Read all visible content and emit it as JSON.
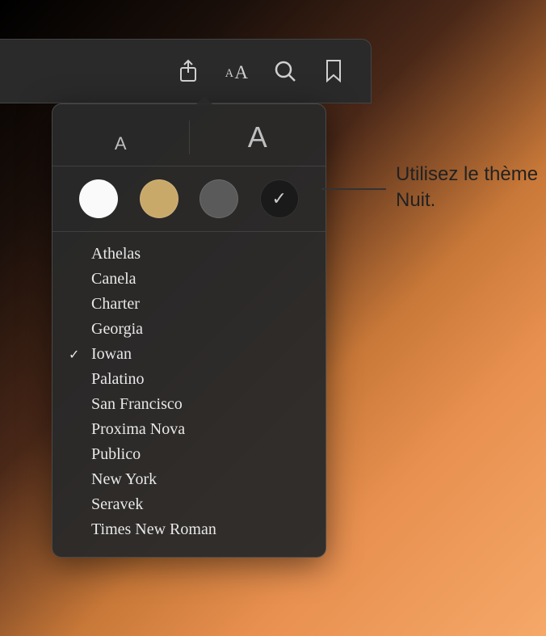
{
  "toolbar": {
    "icons": {
      "share": "share-icon",
      "appearance": "appearance-icon",
      "search": "search-icon",
      "bookmark": "bookmark-icon"
    }
  },
  "popover": {
    "size_small": "A",
    "size_large": "A",
    "themes": {
      "white": "#fafafa",
      "sepia": "#c9a96a",
      "gray": "#5a5a5a",
      "night": "#1a1a1a",
      "selected": "night"
    },
    "fonts": [
      {
        "label": "Athelas",
        "selected": false
      },
      {
        "label": "Canela",
        "selected": false
      },
      {
        "label": "Charter",
        "selected": false
      },
      {
        "label": "Georgia",
        "selected": false
      },
      {
        "label": "Iowan",
        "selected": true
      },
      {
        "label": "Palatino",
        "selected": false
      },
      {
        "label": "San Francisco",
        "selected": false
      },
      {
        "label": "Proxima Nova",
        "selected": false
      },
      {
        "label": "Publico",
        "selected": false
      },
      {
        "label": "New York",
        "selected": false
      },
      {
        "label": "Seravek",
        "selected": false
      },
      {
        "label": "Times New Roman",
        "selected": false
      }
    ]
  },
  "callout": {
    "text": "Utilisez le thème Nuit."
  }
}
